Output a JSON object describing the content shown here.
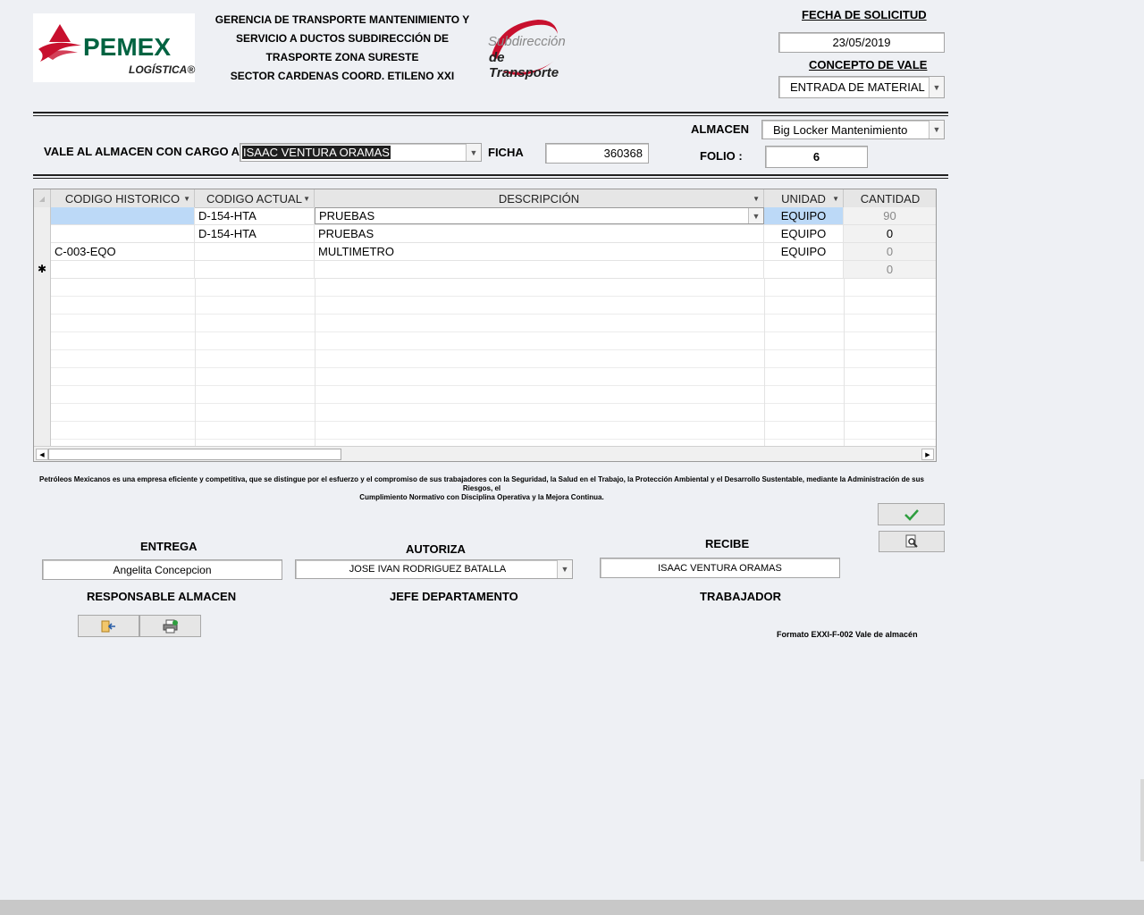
{
  "header": {
    "logo_brand": "PEMEX",
    "logo_sub": "LOGÍSTICA®",
    "title_lines": [
      "GERENCIA DE TRANSPORTE MANTENIMIENTO Y",
      "SERVICIO A DUCTOS SUBDIRECCIÓN DE",
      "TRASPORTE ZONA SURESTE",
      "SECTOR CARDENAS COORD. ETILENO XXI"
    ],
    "sub_logo_line1": "Subdirección",
    "sub_logo_line2": "de Transporte"
  },
  "fecha": {
    "label": "FECHA DE SOLICITUD",
    "value": "23/05/2019"
  },
  "concepto": {
    "label": "CONCEPTO DE VALE",
    "value": "ENTRADA DE MATERIAL"
  },
  "almacen": {
    "label": "ALMACEN",
    "value": "Big Locker Mantenimiento"
  },
  "cargo": {
    "label": "VALE AL ALMACEN CON CARGO A:",
    "value": "ISAAC VENTURA ORAMAS"
  },
  "ficha": {
    "label": "FICHA",
    "value": "360368"
  },
  "folio": {
    "label": "FOLIO :",
    "value": "6"
  },
  "grid": {
    "columns": [
      "CODIGO HISTORICO",
      "CODIGO ACTUAL",
      "DESCRIPCIÓN",
      "UNIDAD",
      "CANTIDAD"
    ],
    "rows": [
      [
        "",
        "D-154-HTA",
        "PRUEBAS",
        "EQUIPO",
        "90"
      ],
      [
        "",
        "D-154-HTA",
        "PRUEBAS",
        "EQUIPO",
        "0"
      ],
      [
        "C-003-EQO",
        "",
        "MULTIMETRO",
        "EQUIPO",
        "0"
      ]
    ],
    "new_row_marker": "✱",
    "new_row_cantidad": "0"
  },
  "mission_text_1": "Petróleos Mexicanos es una empresa eficiente y competitiva, que se distingue por el esfuerzo y el compromiso de sus trabajadores con la Seguridad, la Salud en el Trabajo, la Protección Ambiental y el Desarrollo Sustentable, mediante la Administración de sus Riesgos, el",
  "mission_text_2": "Cumplimiento Normativo con Disciplina Operativa y la Mejora Continua.",
  "entrega": {
    "label": "ENTREGA",
    "value": "Angelita Concepcion",
    "role": "RESPONSABLE ALMACEN"
  },
  "autoriza": {
    "label": "AUTORIZA",
    "value": "JOSE IVAN RODRIGUEZ BATALLA",
    "role": "JEFE DEPARTAMENTO"
  },
  "recibe": {
    "label": "RECIBE",
    "value": "ISAAC VENTURA ORAMAS",
    "role": "TRABAJADOR"
  },
  "formato": "Formato EXXI-F-002 Vale de almacén",
  "colors": {
    "pemex_red": "#c8102e",
    "pemex_green": "#006341",
    "selected_cell": "#bcd9f7",
    "check_green": "#2e9e3f"
  }
}
